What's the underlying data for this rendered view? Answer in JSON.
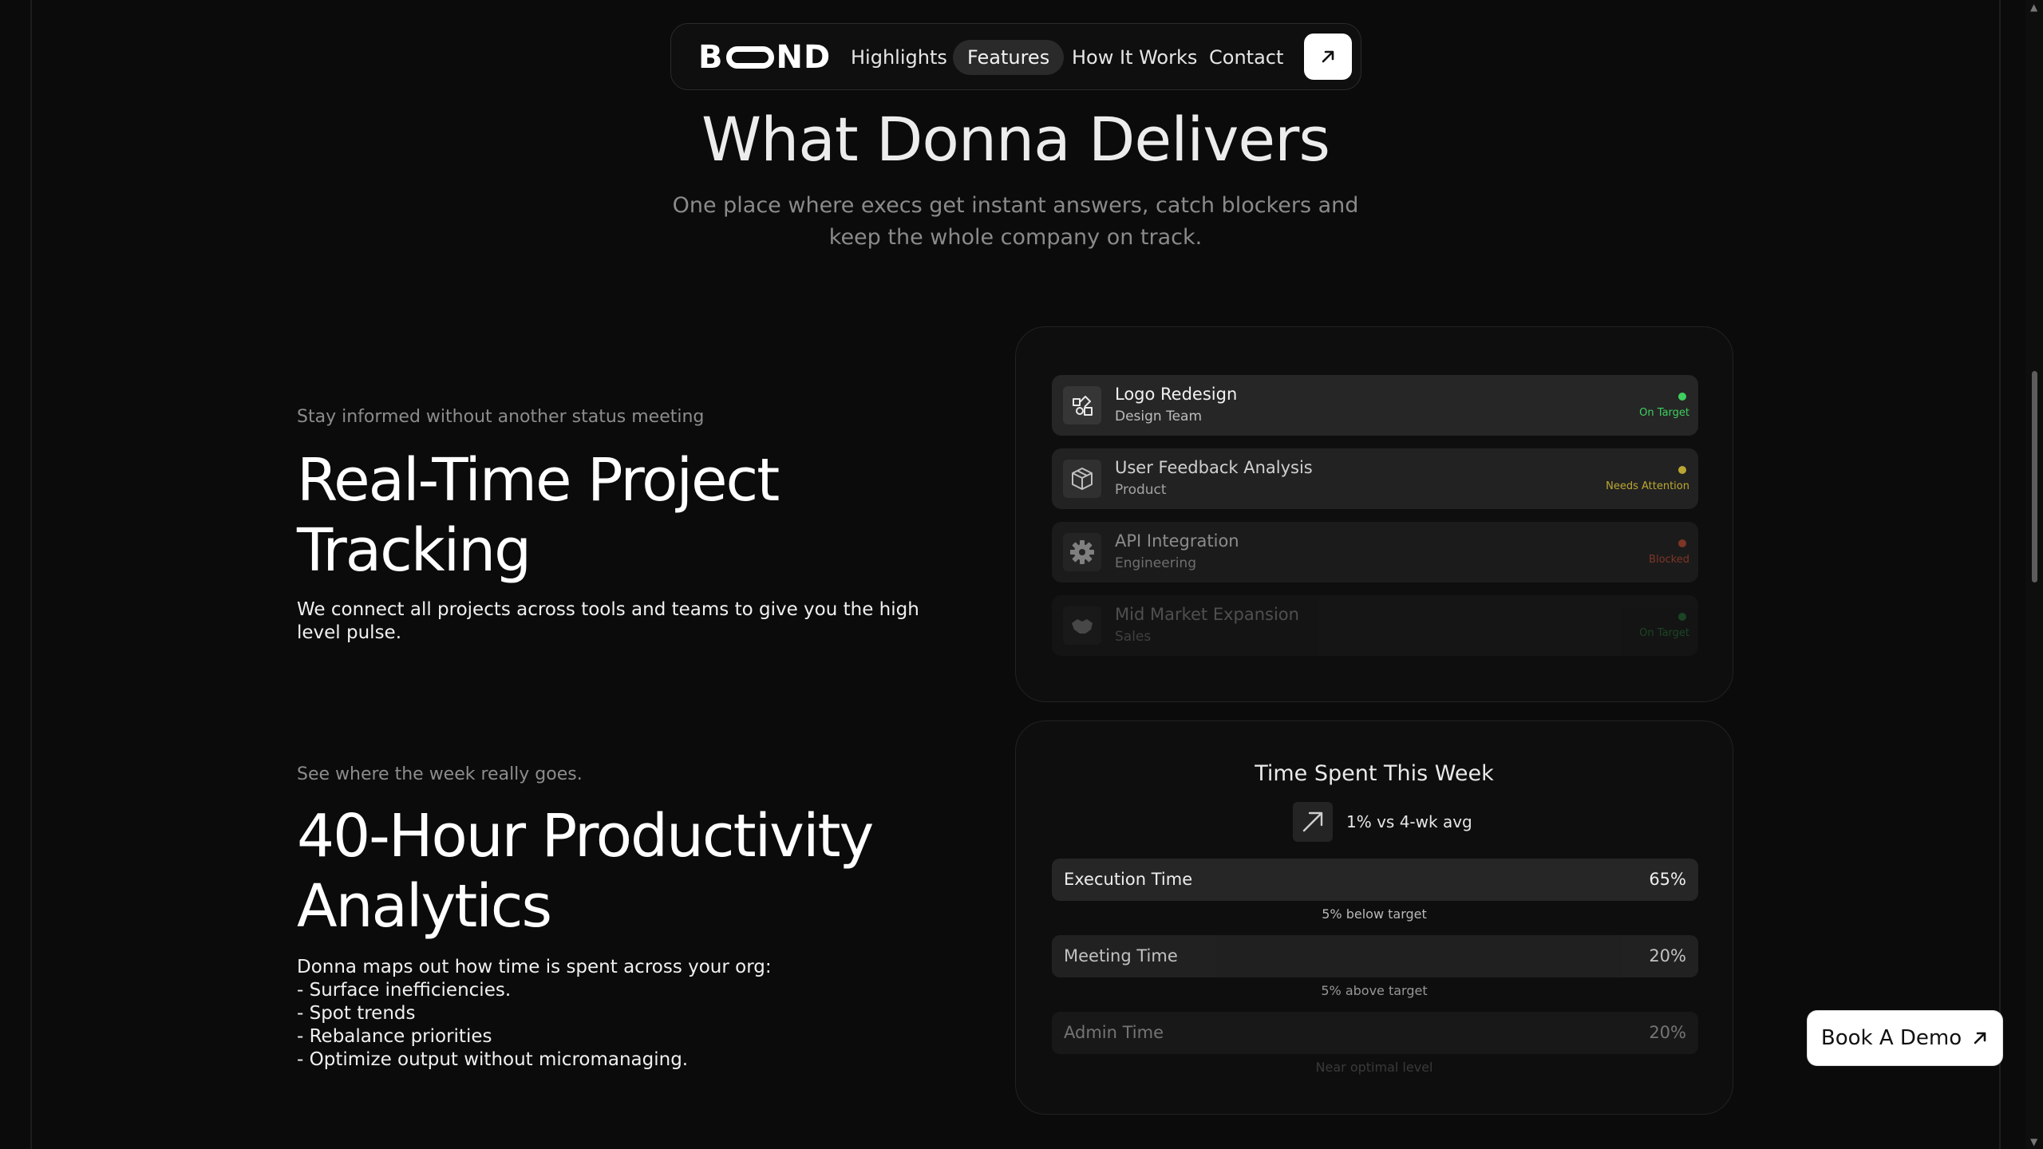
{
  "nav": {
    "logo_text": "BOND",
    "links": [
      {
        "label": "Highlights"
      },
      {
        "label": "Features",
        "active": true
      },
      {
        "label": "How It Works"
      },
      {
        "label": "Contact"
      }
    ],
    "cta_icon": "arrow-up-right-icon"
  },
  "hero": {
    "title": "What Donna Delivers",
    "subtitle": "One place where execs get instant answers, catch blockers and keep the whole company on track."
  },
  "section1": {
    "eyebrow": "Stay informed without another status meeting",
    "title": "Real-Time Project Tracking",
    "body": "We connect all projects across tools and teams to give you the high level pulse."
  },
  "section2": {
    "eyebrow": "See where the week really goes.",
    "title": "40-Hour Productivity Analytics",
    "body_lines": [
      "Donna maps out how time is spent across your org:",
      "- Surface inefficiencies.",
      "- Spot trends",
      "- Rebalance priorities",
      "- Optimize output without micromanaging."
    ]
  },
  "projects": [
    {
      "name": "Logo Redesign",
      "team": "Design Team",
      "status": "On Target",
      "status_color": "#3fcf5e",
      "icon": "design-icon"
    },
    {
      "name": "User Feedback Analysis",
      "team": "Product",
      "status": "Needs Attention",
      "status_color": "#d8c23a",
      "icon": "cube-icon"
    },
    {
      "name": "API Integration",
      "team": "Engineering",
      "status": "Blocked",
      "status_color": "#d9553b",
      "icon": "gear-icon"
    },
    {
      "name": "Mid Market Expansion",
      "team": "Sales",
      "status": "On Target",
      "status_color": "#3fcf5e",
      "icon": "handshake-icon"
    }
  ],
  "time_panel": {
    "title": "Time Spent This Week",
    "trend_text": "1% vs 4-wk avg",
    "trend_icon": "trend-up-arrow-icon",
    "metrics": [
      {
        "label": "Execution Time",
        "value": "65%",
        "note": "5% below target"
      },
      {
        "label": "Meeting Time",
        "value": "20%",
        "note": "5% above target"
      },
      {
        "label": "Admin Time",
        "value": "20%",
        "note": "Near optimal level"
      }
    ]
  },
  "cta": {
    "label": "Book A Demo"
  }
}
